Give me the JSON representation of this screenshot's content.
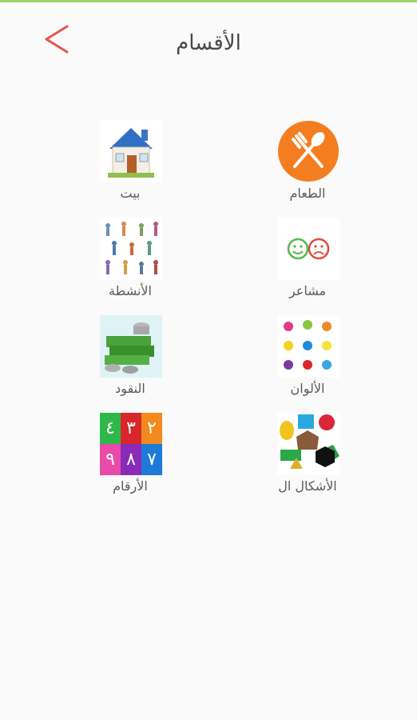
{
  "header": {
    "title": "الأقسام"
  },
  "categories": [
    {
      "label": "الطعام",
      "icon": "food-icon",
      "color": "#f37d1f"
    },
    {
      "label": "بيت",
      "icon": "house-icon"
    },
    {
      "label": "مشاعر",
      "icon": "emotions-icon"
    },
    {
      "label": "الأنشطة",
      "icon": "activities-icon"
    },
    {
      "label": "الألوان",
      "icon": "colors-icon"
    },
    {
      "label": "النقود",
      "icon": "money-icon"
    },
    {
      "label": "الأشكال ال",
      "icon": "shapes-icon"
    },
    {
      "label": "الأرقام",
      "icon": "numbers-icon"
    }
  ],
  "numbers_tile": {
    "digits": [
      "٢",
      "٣",
      "٤",
      "٧",
      "٨",
      "٩"
    ]
  }
}
